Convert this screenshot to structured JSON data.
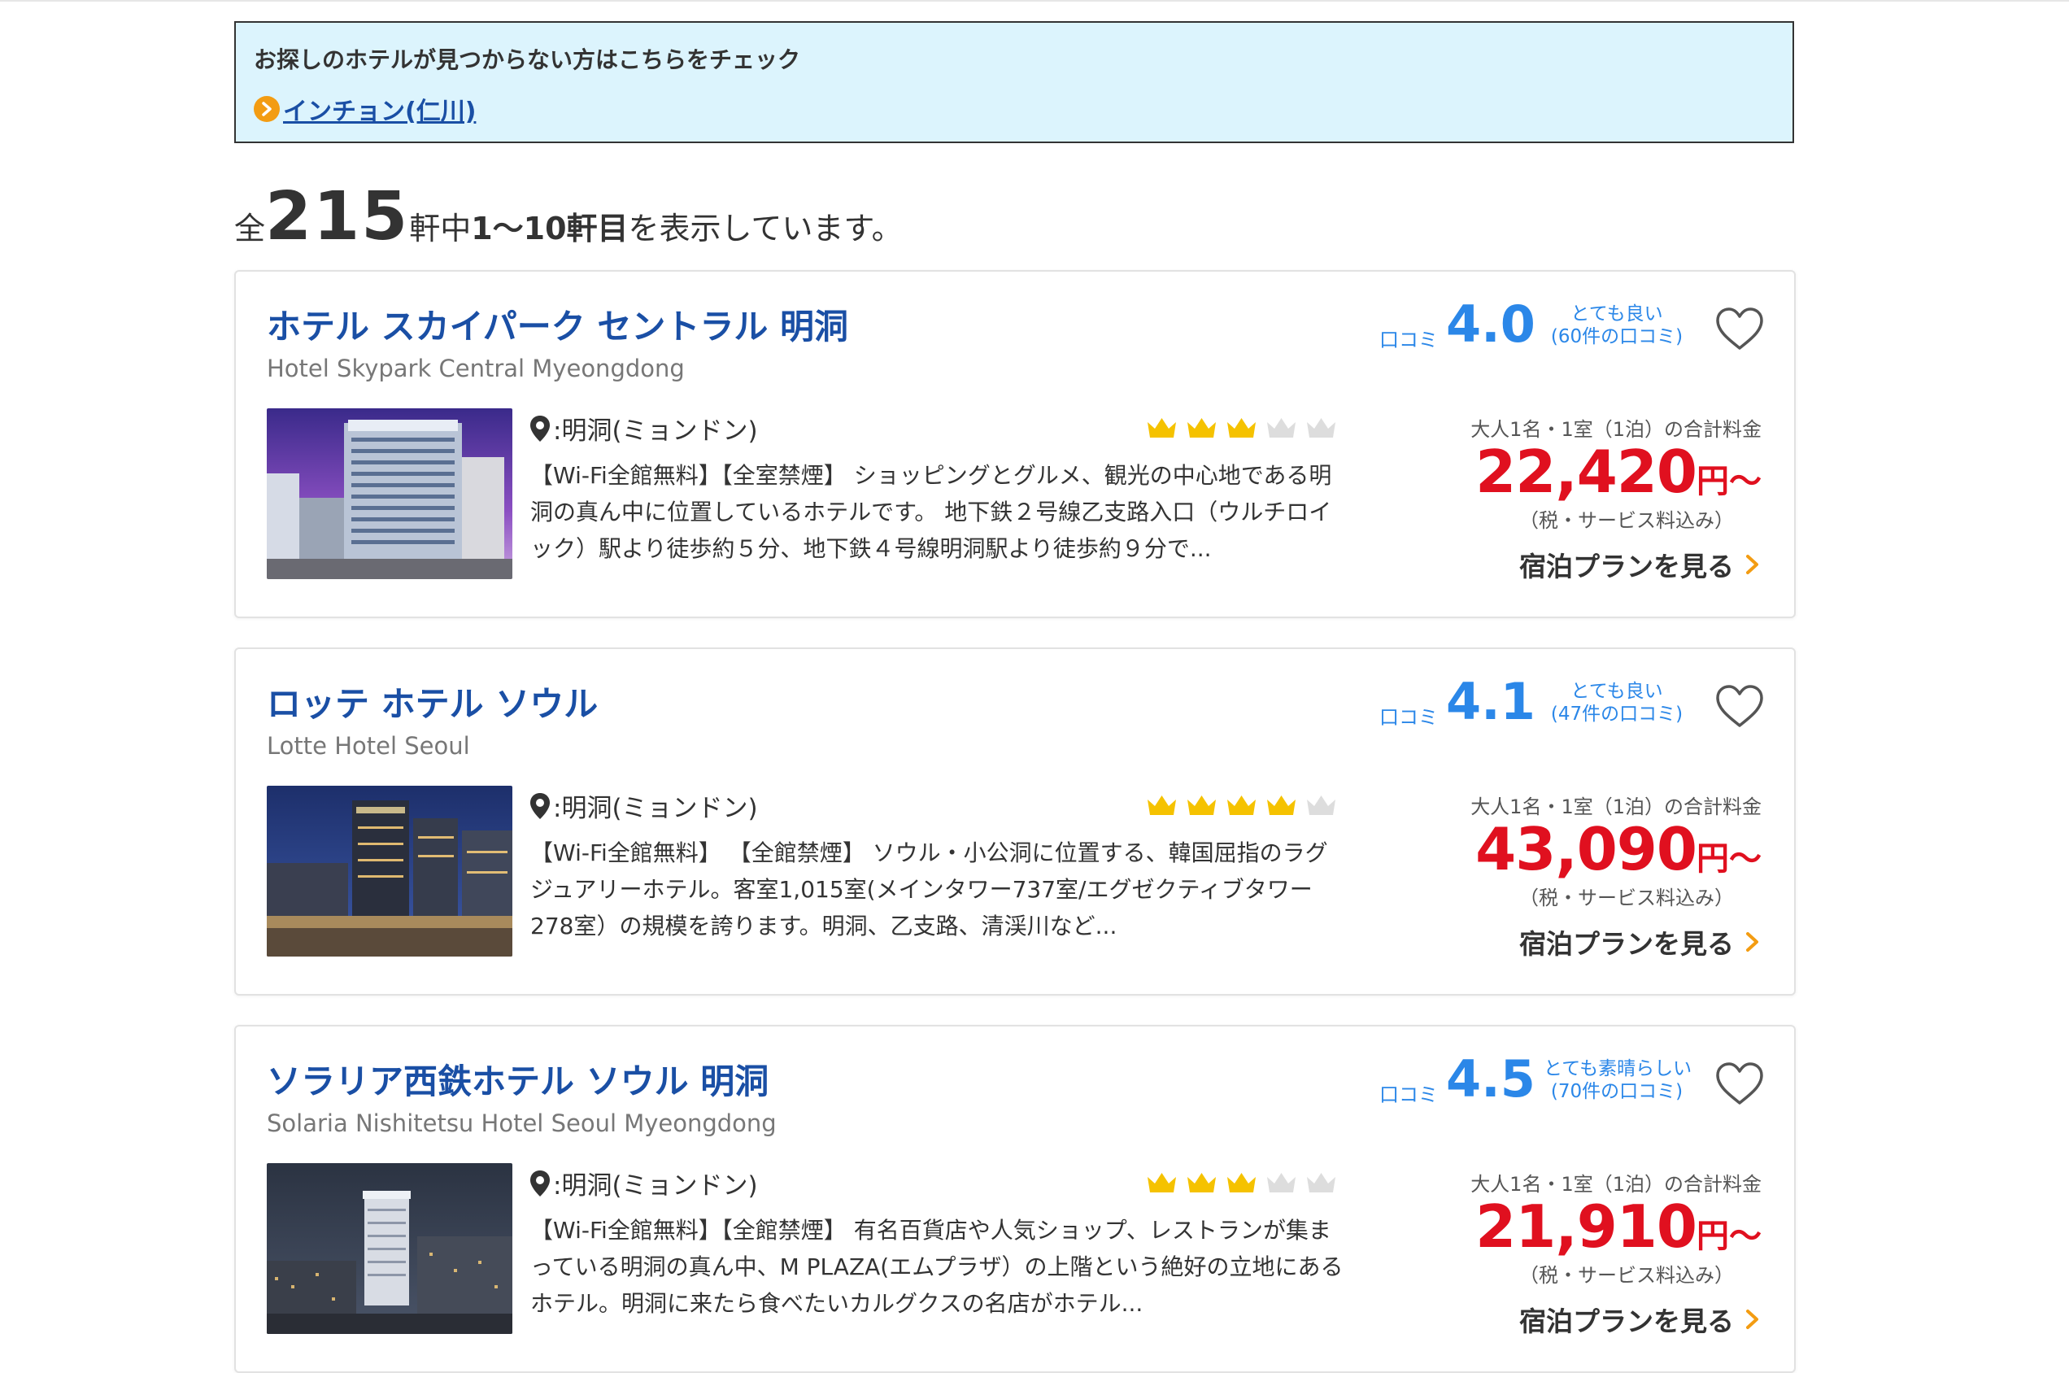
{
  "notice": {
    "title": "お探しのホテルが見つからない方はこちらをチェック",
    "link_label": "インチョン(仁川)"
  },
  "results": {
    "prefix": "全",
    "total": "215",
    "middle": "軒中",
    "range": "1〜10軒目",
    "suffix": "を表示しています。"
  },
  "hotels": [
    {
      "name": "ホテル スカイパーク セントラル 明洞",
      "name_en": "Hotel Skypark Central Myeongdong",
      "review_label": "口コミ",
      "score": "4.0",
      "rating_word": "とても良い",
      "review_count": "(60件の口コミ)",
      "location": ":明洞(ミョンドン)",
      "crowns": 3,
      "description": "【Wi-Fi全館無料】【全室禁煙】 ショッピングとグルメ、観光の中心地である明洞の真ん中に位置しているホテルです。 地下鉄２号線乙支路入口（ウルチロイック）駅より徒歩約５分、地下鉄４号線明洞駅より徒歩約９分で...",
      "price_note": "大人1名・1室（1泊）の合計料金",
      "price": "22,420",
      "price_unit": "円〜",
      "tax_note": "（税・サービス料込み）",
      "plan_label": "宿泊プランを見る"
    },
    {
      "name": "ロッテ ホテル ソウル",
      "name_en": "Lotte Hotel Seoul",
      "review_label": "口コミ",
      "score": "4.1",
      "rating_word": "とても良い",
      "review_count": "(47件の口コミ)",
      "location": ":明洞(ミョンドン)",
      "crowns": 4,
      "description": "【Wi-Fi全館無料】 【全館禁煙】 ソウル・小公洞に位置する、韓国屈指のラグジュアリーホテル。客室1,015室(メインタワー737室/エグゼクティブタワー278室）の規模を誇ります。明洞、乙支路、清渓川など...",
      "price_note": "大人1名・1室（1泊）の合計料金",
      "price": "43,090",
      "price_unit": "円〜",
      "tax_note": "（税・サービス料込み）",
      "plan_label": "宿泊プランを見る"
    },
    {
      "name": "ソラリア西鉄ホテル ソウル 明洞",
      "name_en": "Solaria Nishitetsu Hotel Seoul Myeongdong",
      "review_label": "口コミ",
      "score": "4.5",
      "rating_word": "とても素晴らしい",
      "review_count": "(70件の口コミ)",
      "location": ":明洞(ミョンドン)",
      "crowns": 3,
      "description": "【Wi-Fi全館無料】【全館禁煙】 有名百貨店や人気ショップ、レストランが集まっている明洞の真ん中、M PLAZA(エムプラザ）の上階という絶好の立地にあるホテル。明洞に来たら食べたいカルグクスの名店がホテル...",
      "price_note": "大人1名・1室（1泊）の合計料金",
      "price": "21,910",
      "price_unit": "円〜",
      "tax_note": "（税・サービス料込み）",
      "plan_label": "宿泊プランを見る"
    }
  ],
  "colors": {
    "link_blue": "#1a4fa5",
    "review_blue": "#2b87e8",
    "price_red": "#e0101f",
    "crown_gold": "#f5c200",
    "crown_gray": "#dddddd",
    "notice_bg": "#dcf4fd",
    "accent_orange": "#f39c12"
  },
  "icons": {
    "notice_link": "circle-chevron-right-icon",
    "favorite": "heart-outline-icon",
    "location": "map-pin-icon",
    "rating": "crown-icon",
    "plan": "chevron-right-icon"
  }
}
